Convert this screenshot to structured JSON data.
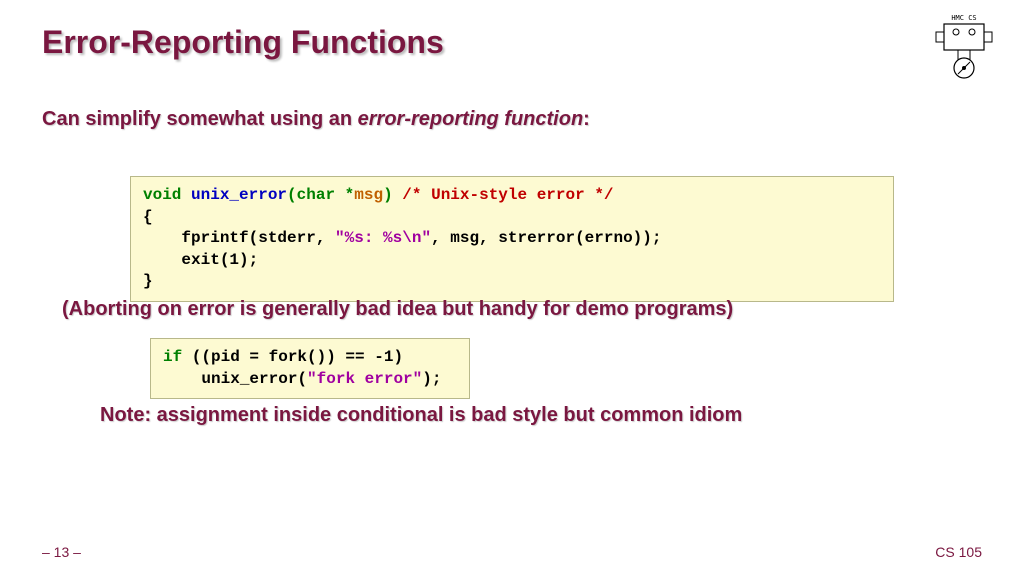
{
  "title": "Error-Reporting Functions",
  "intro": {
    "lead": "Can simplify somewhat using an ",
    "emph": "error-reporting function",
    "tail": ":"
  },
  "code1": {
    "l1a": "void",
    "l1b": " ",
    "l1c": "unix_error",
    "l1d": "(",
    "l1e": "char",
    "l1f": " *",
    "l1g": "msg",
    "l1h": ")",
    "l1i": " ",
    "l1j": "/* Unix-style error */",
    "l2": "{",
    "l3a": "    fprintf(stderr, ",
    "l3b": "\"%s: %s\\n\"",
    "l3c": ", msg, strerror(errno));",
    "l4": "    exit(1);",
    "l5": "}"
  },
  "note1": "(Aborting on error is generally bad idea but handy for demo programs)",
  "code2": {
    "l1a": "if",
    "l1b": " ((pid = fork()) == -1)",
    "l2a": "    unix_error(",
    "l2b": "\"fork error\"",
    "l2c": ");"
  },
  "note2": "Note: assignment inside conditional is bad style but common idiom",
  "footer": {
    "left": "– 13 –",
    "right": "CS 105"
  },
  "logo_label": "HMC CS"
}
